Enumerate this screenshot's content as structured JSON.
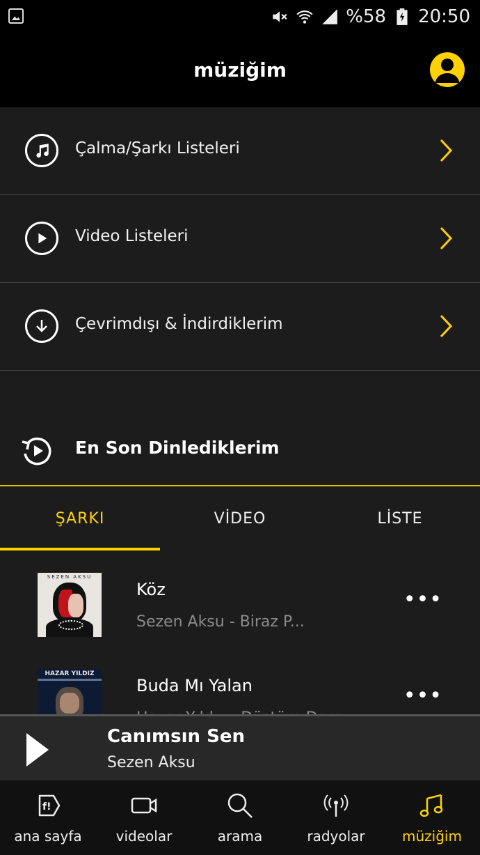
{
  "status_bar": {
    "battery_text": "%58",
    "time": "20:50"
  },
  "header": {
    "title": "müziğim"
  },
  "menu": [
    {
      "label": "Çalma/Şarkı Listeleri",
      "icon": "music-note-icon"
    },
    {
      "label": "Video Listeleri",
      "icon": "play-circle-icon"
    },
    {
      "label": "Çevrimdışı & İndirdiklerim",
      "icon": "download-circle-icon"
    }
  ],
  "recent": {
    "label": "En Son Dinlediklerim"
  },
  "tabs": [
    {
      "label": "ŞARKI",
      "active": true
    },
    {
      "label": "VİDEO",
      "active": false
    },
    {
      "label": "LİSTE",
      "active": false
    }
  ],
  "songs": [
    {
      "title": "Köz",
      "subtitle": "Sezen Aksu - Biraz P...",
      "cover_text": "SEZEN AKSU"
    },
    {
      "title": "Buda Mı Yalan",
      "subtitle": "Hazar Yıldız - Düştüm Dara...",
      "cover_text": "HAZAR YILDIZ"
    }
  ],
  "now_playing": {
    "title": "Canımsın Sen",
    "artist": "Sezen Aksu"
  },
  "bottom_nav": [
    {
      "label": "ana sayfa",
      "icon": "fizy-logo-icon",
      "active": false
    },
    {
      "label": "videolar",
      "icon": "video-camera-icon",
      "active": false
    },
    {
      "label": "arama",
      "icon": "search-icon",
      "active": false
    },
    {
      "label": "radyolar",
      "icon": "radio-antenna-icon",
      "active": false
    },
    {
      "label": "müziğim",
      "icon": "music-note-icon",
      "active": true
    }
  ],
  "colors": {
    "accent": "#ffd100",
    "background": "#1c1c1c",
    "header": "#000000"
  }
}
